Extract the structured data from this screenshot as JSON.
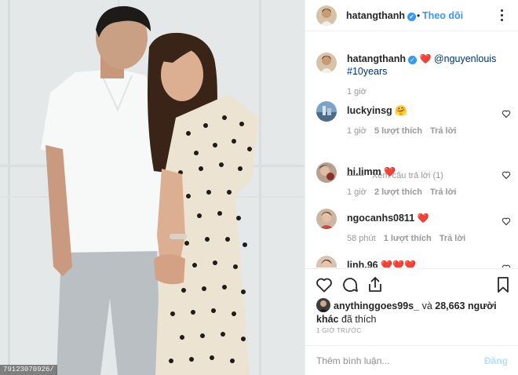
{
  "photo": {
    "caption": "79123070926/"
  },
  "header": {
    "username": "hatangthanh",
    "verified_mark": "✓",
    "separator": "•",
    "follow_label": "Theo dõi",
    "more_icon": "more-options-icon"
  },
  "caption": {
    "username": "hatangthanh",
    "verified_mark": "✓",
    "heart": "❤️",
    "mention": "@nguyenlouis",
    "hashtag": "#10years",
    "time": "1 giờ"
  },
  "comments": [
    {
      "username": "luckyinsg",
      "text": "🤗",
      "time": "1 giờ",
      "likes": "5 lượt thích",
      "reply_label": "Trả lời"
    },
    {
      "username": "hi.limm",
      "text": "❤️",
      "time": "1 giờ",
      "likes": "2 lượt thích",
      "reply_label": "Trả lời"
    },
    {
      "username": "ngocanhs0811",
      "text": "❤️",
      "time": "58 phút",
      "likes": "1 lượt thích",
      "reply_label": "Trả lời"
    },
    {
      "username": "linh.96",
      "text": "❤️❤️❤️",
      "time": "",
      "likes": "",
      "reply_label": ""
    }
  ],
  "view_replies_label": "Xem câu trả lời (1)",
  "actions": {
    "like_icon": "heart-outline-icon",
    "comment_icon": "comment-icon",
    "share_icon": "share-icon",
    "save_icon": "bookmark-icon"
  },
  "likes": {
    "user": "anythinggoes99s_",
    "connector": "và",
    "count_text": "28,663 người khác",
    "suffix": "đã thích"
  },
  "time_ago": "1 GIỜ TRƯỚC",
  "add_comment": {
    "placeholder": "Thêm bình luận...",
    "post_label": "Đăng"
  },
  "colors": {
    "accent": "#3897f0",
    "heart": "#ed4956",
    "post_disabled": "#b2dffc"
  }
}
